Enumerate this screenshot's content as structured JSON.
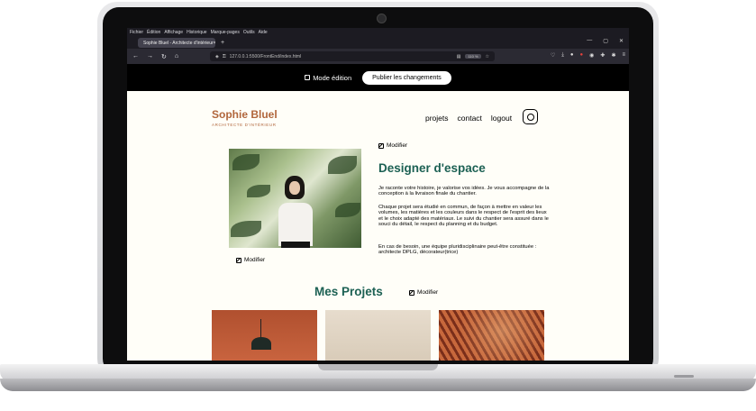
{
  "browser": {
    "menu": [
      "Fichier",
      "Édition",
      "Affichage",
      "Historique",
      "Marque-pages",
      "Outils",
      "Aide"
    ],
    "tab_title": "Sophie Bluel - Architecte d'intérieur",
    "tab_close": "×",
    "new_tab": "+",
    "window_controls": [
      "—",
      "▢",
      "✕"
    ],
    "url": "127.0.0.1:5500/FrontEnd/index.html",
    "zoom": "110 %"
  },
  "editbar": {
    "mode_label": "Mode édition",
    "publish_label": "Publier les changements"
  },
  "header": {
    "logo_name": "Sophie Bluel",
    "logo_sub": "ARCHITECTE D'INTÉRIEUR",
    "nav": [
      "projets",
      "contact",
      "logout"
    ]
  },
  "intro": {
    "modify_top": "Modifier",
    "modify_photo": "Modifier",
    "title": "Designer d'espace",
    "paragraphs": [
      "Je raconte votre histoire, je valorise vos idées. Je vous accompagne de la conception à la livraison finale du chantier.",
      "Chaque projet sera étudié en commun, de façon à mettre en valeur les volumes, les matières et les couleurs dans le respect de l'esprit des lieux et le choix adapté des matériaux. Le suivi du chantier sera assuré dans le souci du détail, le respect du planning et du budget.",
      "En cas de besoin, une équipe pluridisciplinaire peut-être constituée : architecte DPLG, décorateur(trice)"
    ]
  },
  "projects": {
    "title": "Mes Projets",
    "modify": "Modifier"
  },
  "colors": {
    "accent_green": "#1d6154",
    "logo_orange": "#b1663c",
    "background": "#fffef8"
  },
  "icons": [
    "edit-icon",
    "instagram-icon",
    "back-icon",
    "forward-icon",
    "reload-icon",
    "home-icon",
    "shield-icon",
    "lock-icon",
    "star-icon"
  ]
}
